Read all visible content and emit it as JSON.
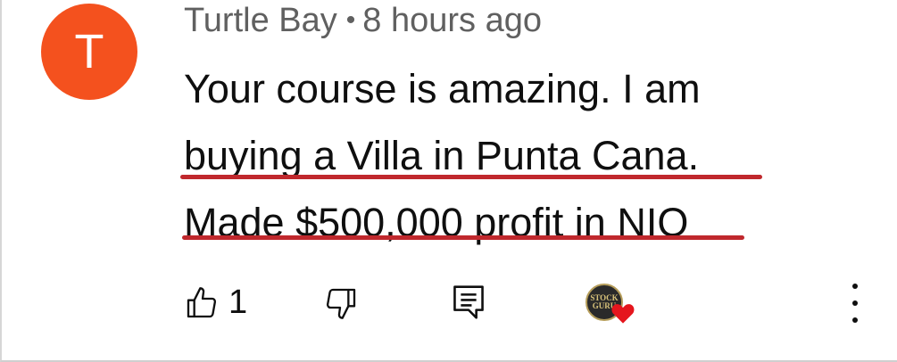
{
  "comment": {
    "avatar_letter": "T",
    "author": "Turtle Bay",
    "separator": "•",
    "time": "8 hours ago",
    "lines": [
      "Your course is amazing. I am",
      "buying a Villa in Punta Cana.",
      "Made $500,000 profit in NIO"
    ]
  },
  "actions": {
    "like_count": "1",
    "creator_heart_logo_text": "STOCK GURU"
  },
  "colors": {
    "avatar_bg": "#f4511e",
    "underline": "#c0282d",
    "heart": "#e5161d"
  },
  "icons": [
    "thumbs-up-icon",
    "thumbs-down-icon",
    "reply-comment-icon",
    "creator-heart-icon",
    "more-vertical-icon"
  ]
}
